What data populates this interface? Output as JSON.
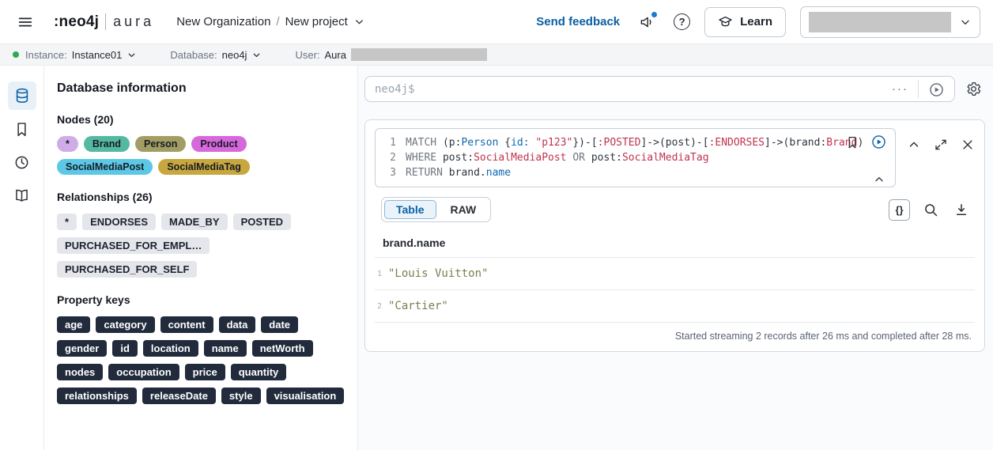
{
  "header": {
    "logo_primary": ":neo4j",
    "logo_secondary": "aura",
    "breadcrumb": {
      "organization": "New Organization",
      "separator": "/",
      "project": "New project"
    },
    "send_feedback": "Send feedback",
    "help_glyph": "?",
    "learn": "Learn"
  },
  "status_bar": {
    "instance_label": "Instance:",
    "instance_value": "Instance01",
    "database_label": "Database:",
    "database_value": "neo4j",
    "user_label": "User:",
    "user_value": "Aura"
  },
  "side_panel": {
    "title": "Database information",
    "nodes_heading": "Nodes (20)",
    "node_labels": [
      {
        "label": "*",
        "color": "#CFACE8"
      },
      {
        "label": "Brand",
        "color": "#55B9A1"
      },
      {
        "label": "Person",
        "color": "#A29D63"
      },
      {
        "label": "Product",
        "color": "#D768DC"
      },
      {
        "label": "SocialMediaPost",
        "color": "#5CC8E6"
      },
      {
        "label": "SocialMediaTag",
        "color": "#C8A73E"
      }
    ],
    "relationships_heading": "Relationships (26)",
    "relationship_types": [
      "*",
      "ENDORSES",
      "MADE_BY",
      "POSTED",
      "PURCHASED_FOR_EMPL…",
      "PURCHASED_FOR_SELF"
    ],
    "property_keys_heading": "Property keys",
    "property_keys": [
      "age",
      "category",
      "content",
      "data",
      "date",
      "gender",
      "id",
      "location",
      "name",
      "netWorth",
      "nodes",
      "occupation",
      "price",
      "quantity",
      "relationships",
      "releaseDate",
      "style",
      "visualisation"
    ]
  },
  "query_bar": {
    "placeholder": "neo4j$",
    "more_label": "···"
  },
  "editor_card": {
    "code_lines": [
      {
        "num": "1",
        "tokens": [
          {
            "c": "k",
            "t": "MATCH"
          },
          {
            "c": "p",
            "t": " (p:"
          },
          {
            "c": "b",
            "t": "Person"
          },
          {
            "c": "p",
            "t": " {"
          },
          {
            "c": "b",
            "t": "id:"
          },
          {
            "c": "p",
            "t": " "
          },
          {
            "c": "r",
            "t": "\"p123\""
          },
          {
            "c": "p",
            "t": "})-["
          },
          {
            "c": "r",
            "t": ":POSTED"
          },
          {
            "c": "p",
            "t": "]->(post)-["
          },
          {
            "c": "r",
            "t": ":ENDORSES"
          },
          {
            "c": "p",
            "t": "]->(brand:"
          },
          {
            "c": "r",
            "t": "Brand"
          },
          {
            "c": "p",
            "t": ")"
          }
        ]
      },
      {
        "num": "2",
        "tokens": [
          {
            "c": "k",
            "t": "WHERE"
          },
          {
            "c": "p",
            "t": " post:"
          },
          {
            "c": "r",
            "t": "SocialMediaPost"
          },
          {
            "c": "p",
            "t": " "
          },
          {
            "c": "k",
            "t": "OR"
          },
          {
            "c": "p",
            "t": " post:"
          },
          {
            "c": "r",
            "t": "SocialMediaTag"
          }
        ]
      },
      {
        "num": "3",
        "tokens": [
          {
            "c": "k",
            "t": "RETURN"
          },
          {
            "c": "p",
            "t": " brand."
          },
          {
            "c": "b",
            "t": "name"
          }
        ]
      }
    ],
    "tabs": [
      {
        "label": "Table",
        "active": true
      },
      {
        "label": "RAW",
        "active": false
      }
    ],
    "braces_icon_label": "{}",
    "table": {
      "column": "brand.name",
      "rows": [
        {
          "num": "1",
          "value": "\"Louis Vuitton\""
        },
        {
          "num": "2",
          "value": "\"Cartier\""
        }
      ]
    },
    "status": "Started streaming 2 records after 26 ms and completed after 28 ms."
  },
  "colors": {
    "accent_blue": "#0B61A4",
    "link_blue": "#0A5FA4",
    "status_green": "#2EA94F",
    "code_keyword": "#6F7780",
    "code_entity_blue": "#0F68B2",
    "code_entity_red": "#C0334E",
    "result_string": "#7C7E4F",
    "redacted_gray": "#C6C6C6"
  }
}
